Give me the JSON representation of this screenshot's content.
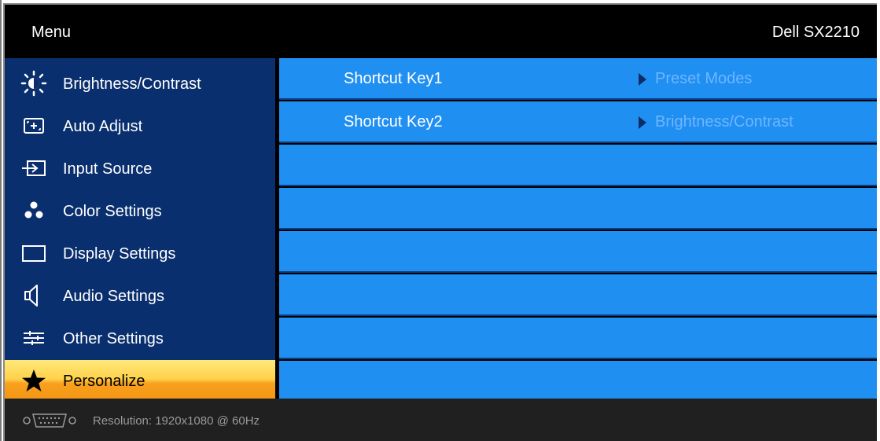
{
  "header": {
    "title": "Menu",
    "model": "Dell SX2210"
  },
  "sidebar": {
    "items": [
      {
        "label": "Brightness/Contrast",
        "icon": "brightness-icon",
        "active": false
      },
      {
        "label": "Auto Adjust",
        "icon": "auto-adjust-icon",
        "active": false
      },
      {
        "label": "Input Source",
        "icon": "input-source-icon",
        "active": false
      },
      {
        "label": "Color Settings",
        "icon": "color-settings-icon",
        "active": false
      },
      {
        "label": "Display Settings",
        "icon": "display-settings-icon",
        "active": false
      },
      {
        "label": "Audio Settings",
        "icon": "speaker-icon",
        "active": false
      },
      {
        "label": "Other Settings",
        "icon": "sliders-icon",
        "active": false
      },
      {
        "label": "Personalize",
        "icon": "star-icon",
        "active": true
      }
    ]
  },
  "panel": {
    "rows": [
      {
        "key": "Shortcut Key1",
        "value": "Preset Modes"
      },
      {
        "key": "Shortcut Key2",
        "value": "Brightness/Contrast"
      }
    ]
  },
  "footer": {
    "icon": "vga-connector-icon",
    "resolution": "Resolution: 1920x1080 @ 60Hz"
  },
  "colors": {
    "sidebar_bg": "#0a2f6e",
    "panel_bg": "#1f8ff2",
    "active_item": "#f8a11e",
    "value_text": "#6fb5ff"
  }
}
